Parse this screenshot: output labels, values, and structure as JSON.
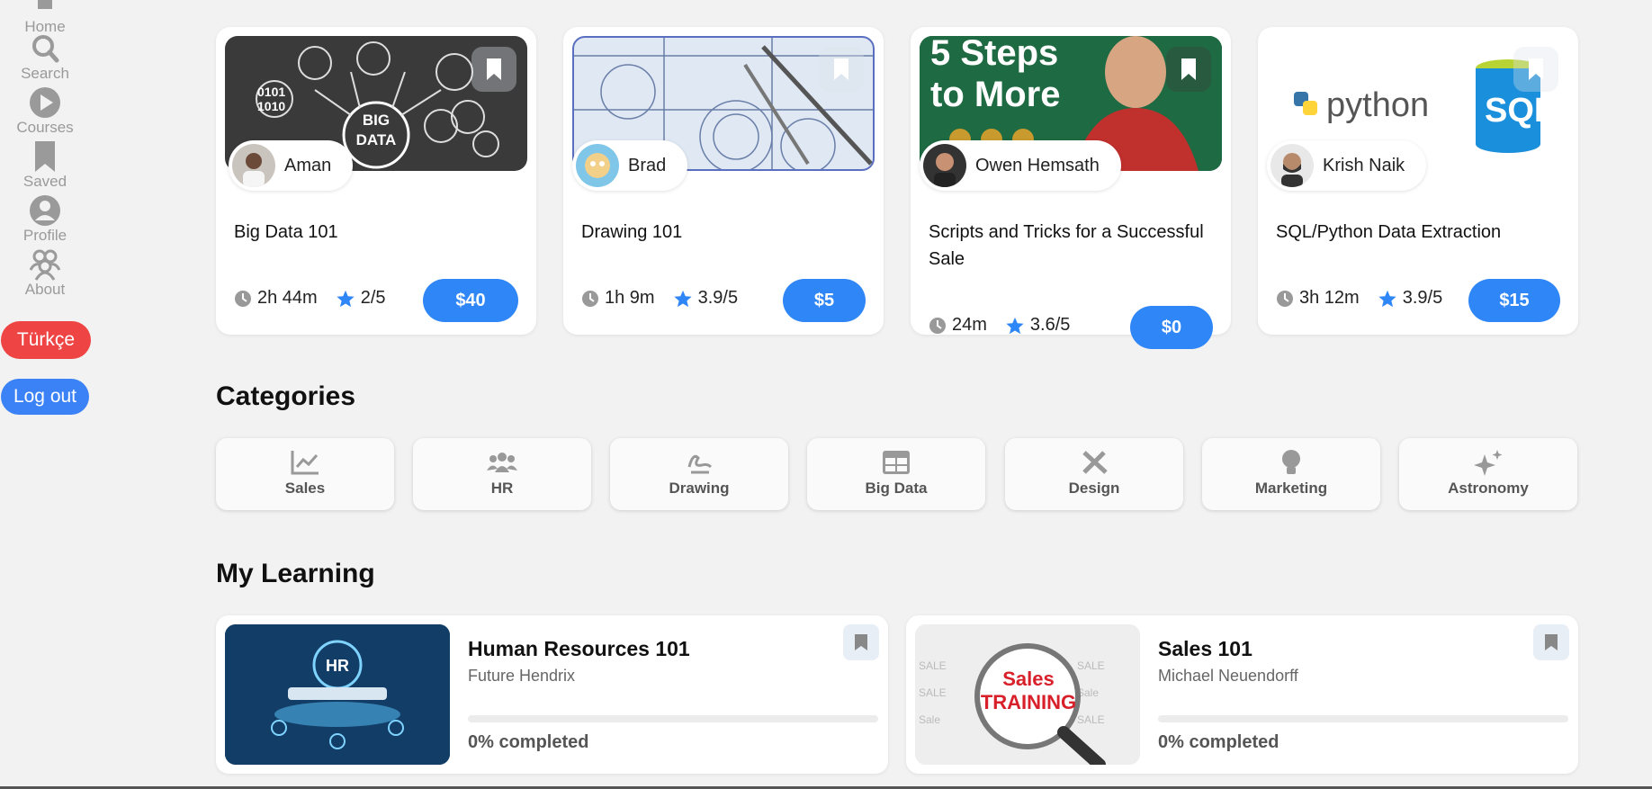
{
  "sidebar": {
    "items": [
      {
        "label": "Home",
        "icon": "home-icon"
      },
      {
        "label": "Search",
        "icon": "search-icon"
      },
      {
        "label": "Courses",
        "icon": "play-icon"
      },
      {
        "label": "Saved",
        "icon": "bookmark-icon"
      },
      {
        "label": "Profile",
        "icon": "user-icon"
      },
      {
        "label": "About",
        "icon": "users-icon"
      }
    ],
    "language_button": "Türkçe",
    "logout_button": "Log out",
    "colors": {
      "language": "#ef4444",
      "logout": "#3b82f6",
      "inactive": "#9a9a9a"
    }
  },
  "courses": [
    {
      "author": "Aman",
      "title": "Big Data 101",
      "duration": "2h 44m",
      "rating": "2/5",
      "price": "$40",
      "thumb": "big-data-image"
    },
    {
      "author": "Brad",
      "title": "Drawing 101",
      "duration": "1h 9m",
      "rating": "3.9/5",
      "price": "$5",
      "thumb": "blueprint-drawing-image"
    },
    {
      "author": "Owen Hemsath",
      "title": "Scripts and Tricks for a Successful Sale",
      "duration": "24m",
      "rating": "3.6/5",
      "price": "$0",
      "thumb": "sales-video-image",
      "thumb_text": [
        "5 Steps",
        "to More"
      ]
    },
    {
      "author": "Krish Naik",
      "title": "SQL/Python Data Extraction",
      "duration": "3h 12m",
      "rating": "3.9/5",
      "price": "$15",
      "thumb": "python-sql-image",
      "thumb_text": [
        "python",
        "SQL"
      ]
    }
  ],
  "categories_section": {
    "title": "Categories",
    "items": [
      {
        "label": "Sales",
        "icon": "chart-line-icon"
      },
      {
        "label": "HR",
        "icon": "people-group-icon"
      },
      {
        "label": "Drawing",
        "icon": "signature-icon"
      },
      {
        "label": "Big Data",
        "icon": "table-icon"
      },
      {
        "label": "Design",
        "icon": "pencil-ruler-icon"
      },
      {
        "label": "Marketing",
        "icon": "lightbulb-icon"
      },
      {
        "label": "Astronomy",
        "icon": "sparkles-icon"
      }
    ]
  },
  "learning_section": {
    "title": "My Learning",
    "items": [
      {
        "title": "Human Resources 101",
        "author": "Future Hendrix",
        "progress_label": "0% completed",
        "progress": 0,
        "thumb": "hr-hologram-image"
      },
      {
        "title": "Sales 101",
        "author": "Michael Neuendorff",
        "progress_label": "0% completed",
        "progress": 0,
        "thumb": "sales-training-magnifier-image",
        "thumb_text": "Sales TRAINING"
      }
    ]
  },
  "accent_color": "#2f86f6"
}
